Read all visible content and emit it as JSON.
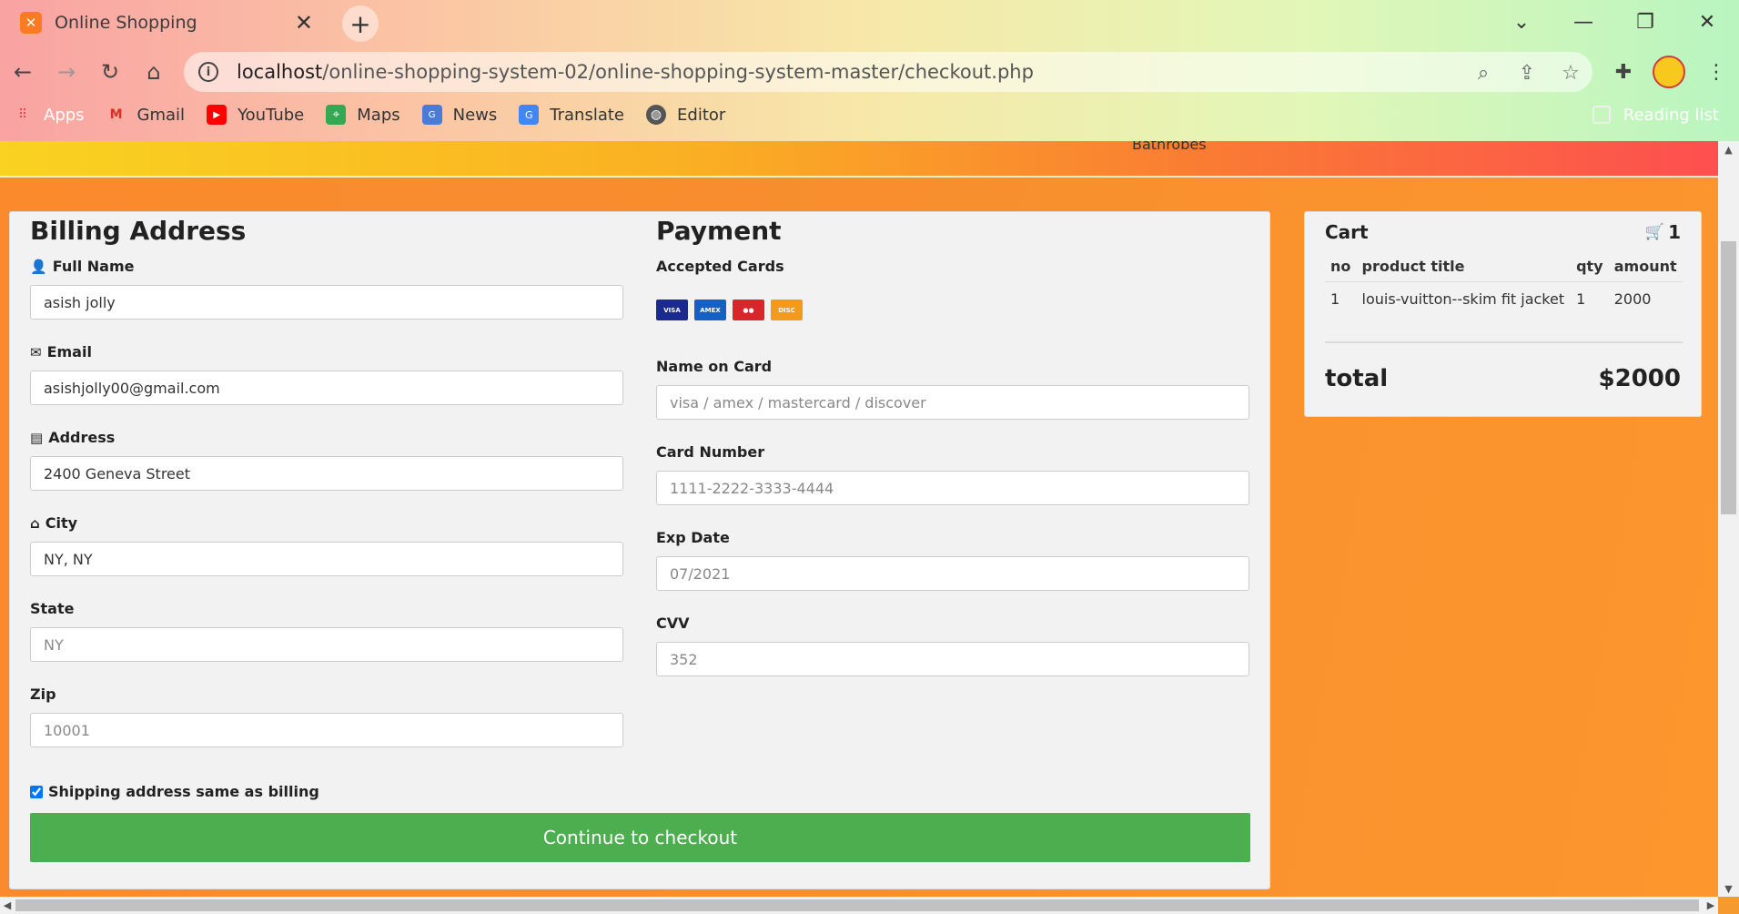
{
  "browser": {
    "tab_title": "Online Shopping",
    "tab_close": "✕",
    "new_tab": "+",
    "url_host": "localhost",
    "url_path": "/online-shopping-system-02/online-shopping-system-master/checkout.php",
    "bookmarks": [
      {
        "label": "Apps",
        "icon": "apps-grid-icon"
      },
      {
        "label": "Gmail",
        "icon": "gmail-icon"
      },
      {
        "label": "YouTube",
        "icon": "youtube-icon"
      },
      {
        "label": "Maps",
        "icon": "maps-icon"
      },
      {
        "label": "News",
        "icon": "news-icon"
      },
      {
        "label": "Translate",
        "icon": "translate-icon"
      },
      {
        "label": "Editor",
        "icon": "editor-globe-icon"
      }
    ],
    "reading_list": "Reading list"
  },
  "page": {
    "category_fragment": "Bathrobes"
  },
  "billing": {
    "title": "Billing Address",
    "full_name_label": "Full Name",
    "full_name_value": "asish jolly",
    "email_label": "Email",
    "email_value": "asishjolly00@gmail.com",
    "address_label": "Address",
    "address_value": "2400 Geneva Street",
    "city_label": "City",
    "city_value": "NY, NY",
    "state_label": "State",
    "state_placeholder": "NY",
    "zip_label": "Zip",
    "zip_placeholder": "10001",
    "shipping_same_label": "Shipping address same as billing",
    "shipping_same_checked": true
  },
  "payment": {
    "title": "Payment",
    "accepted_cards_label": "Accepted Cards",
    "cards": [
      "VISA",
      "AMEX",
      "MC",
      "DISCOVER"
    ],
    "name_on_card_label": "Name on Card",
    "name_on_card_placeholder": "visa / amex / mastercard / discover",
    "card_number_label": "Card Number",
    "card_number_placeholder": "1111-2222-3333-4444",
    "exp_date_label": "Exp Date",
    "exp_date_placeholder": "07/2021",
    "cvv_label": "CVV",
    "cvv_placeholder": "352"
  },
  "checkout_button": "Continue to checkout",
  "cart": {
    "title": "Cart",
    "count": "1",
    "columns": [
      "no",
      "product title",
      "qty",
      "amount"
    ],
    "rows": [
      {
        "no": "1",
        "title": "louis-vuitton--skim fit jacket",
        "qty": "1",
        "amount": "2000"
      }
    ],
    "total_label": "total",
    "total_value": "$2000"
  },
  "colors": {
    "checkout_green": "#4cae4f",
    "page_orange": "#f78d2e",
    "card_bg": "#f2f2f2"
  }
}
